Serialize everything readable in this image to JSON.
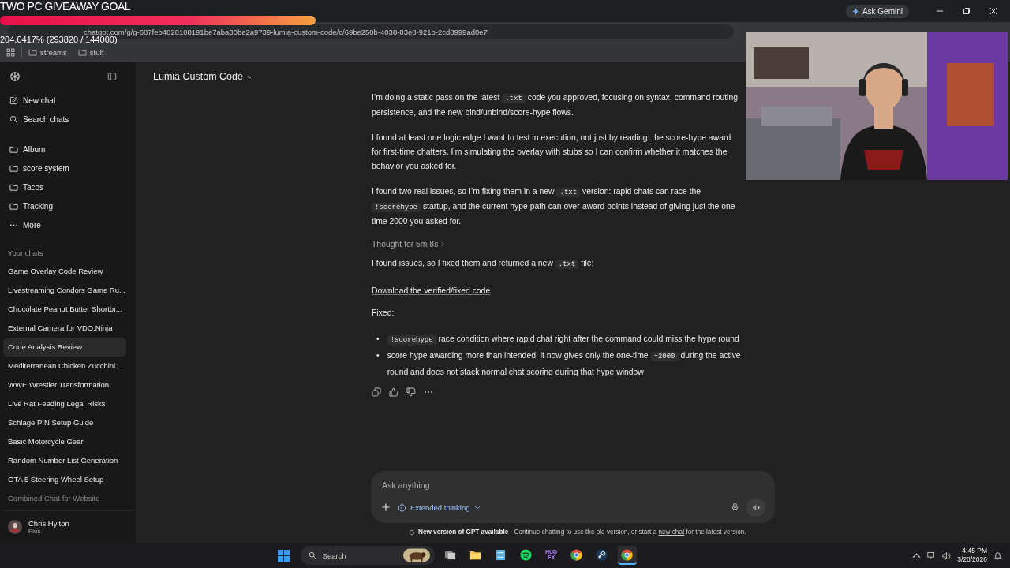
{
  "stream_overlay": {
    "goal_title": "TWO PC GIVEAWAY GOAL",
    "goal_progress": {
      "level": 1
    },
    "goal_reading": "204.0417% (293820 / 144000)"
  },
  "browser": {
    "gemini_button": "Ask Gemini",
    "url": "chatgpt.com/g/g-687feb4828108191be7aba30be2a9739-lumia-custom-code/c/69be250b-4038-83e8-921b-2cd8999ad0e7",
    "bookmarks": [
      "streams",
      "stuff"
    ]
  },
  "sidebar": {
    "nav": [
      {
        "label": "New chat",
        "kind": "edit"
      },
      {
        "label": "Search chats",
        "kind": "search"
      }
    ],
    "projects": [
      {
        "label": "Album",
        "kind": "folder"
      },
      {
        "label": "score system",
        "kind": "folder"
      },
      {
        "label": "Tacos",
        "kind": "folder"
      },
      {
        "label": "Tracking",
        "kind": "folder"
      },
      {
        "label": "More",
        "kind": "more"
      }
    ],
    "chats_heading": "Your chats",
    "chats": [
      {
        "title": "Game Overlay Code Review",
        "selected": false
      },
      {
        "title": "Livestreaming Condors Game Ru...",
        "selected": false
      },
      {
        "title": "Chocolate Peanut Butter Shortbr...",
        "selected": false
      },
      {
        "title": "External Camera for VDO.Ninja",
        "selected": false
      },
      {
        "title": "Code Analysis Review",
        "selected": true
      },
      {
        "title": "Mediterranean Chicken Zucchini...",
        "selected": false
      },
      {
        "title": "WWE Wrestler Transformation",
        "selected": false
      },
      {
        "title": "Live Rat Feeding Legal Risks",
        "selected": false
      },
      {
        "title": "Schlage PIN Setup Guide",
        "selected": false
      },
      {
        "title": "Basic Motorcycle Gear",
        "selected": false
      },
      {
        "title": "Random Number List Generation",
        "selected": false
      },
      {
        "title": "GTA 5 Steering Wheel Setup",
        "selected": false
      },
      {
        "title": "Combined Chat for Website",
        "selected": false
      }
    ],
    "user": {
      "name": "Chris Hylton",
      "plan": "Plus"
    }
  },
  "chat": {
    "title": "Lumia Custom Code",
    "blocks": [
      {
        "kind": "paragraph",
        "parts": [
          {
            "kind": "text",
            "text": "I’m doing a static pass on the latest "
          },
          {
            "kind": "code",
            "text": ".txt"
          },
          {
            "kind": "text",
            "text": " code you approved, focusing on syntax, command routing persistence, and the new bind/unbind/score-hype flows."
          }
        ]
      },
      {
        "kind": "paragraph",
        "parts": [
          {
            "kind": "text",
            "text": "I found at least one logic edge I want to test in execution, not just by reading: the score-hype award for first-time chatters. I’m simulating the overlay with stubs so I can confirm whether it matches the behavior you asked for."
          }
        ]
      },
      {
        "kind": "paragraph",
        "parts": [
          {
            "kind": "text",
            "text": "I found two real issues, so I’m fixing them in a new "
          },
          {
            "kind": "code",
            "text": ".txt"
          },
          {
            "kind": "text",
            "text": " version: rapid chats can race the "
          },
          {
            "kind": "code",
            "text": "!scorehype"
          },
          {
            "kind": "text",
            "text": " startup, and the current hype path can over-award points instead of giving just the one-time 2000 you asked for."
          }
        ]
      },
      {
        "kind": "thought",
        "text": "Thought for 5m 8s"
      },
      {
        "kind": "paragraph",
        "parts": [
          {
            "kind": "text",
            "text": "I found issues, so I fixed them and returned a new "
          },
          {
            "kind": "code",
            "text": ".txt"
          },
          {
            "kind": "text",
            "text": " file:"
          }
        ]
      },
      {
        "kind": "link",
        "text": "Download the verified/fixed code"
      },
      {
        "kind": "paragraph",
        "parts": [
          {
            "kind": "text",
            "text": "Fixed:"
          }
        ]
      },
      {
        "kind": "list",
        "marker": "•",
        "items": [
          [
            {
              "kind": "code",
              "text": "!scorehype"
            },
            {
              "kind": "text",
              "text": " race condition where rapid chat right after the command could miss the hype round"
            }
          ],
          [
            {
              "kind": "text",
              "text": "score hype awarding more than intended; it now gives only the one-time "
            },
            {
              "kind": "code",
              "text": "+2000"
            },
            {
              "kind": "text",
              "text": " during the active round and does not stack normal chat scoring during that hype window"
            }
          ]
        ]
      },
      {
        "kind": "actions"
      }
    ],
    "composer": {
      "placeholder": "Ask anything",
      "mode": "Extended thinking"
    },
    "notice": {
      "text": "**New version of GPT available** - Continue chatting to use the old version, or start a ",
      "link": "new chat",
      "after": " for the latest version."
    }
  },
  "taskbar": {
    "search_placeholder": "Search",
    "apps": [
      {
        "kind": "taskview",
        "active": false
      },
      {
        "kind": "explorer",
        "active": false
      },
      {
        "kind": "notepad",
        "active": false
      },
      {
        "kind": "spotify",
        "active": false
      },
      {
        "kind": "hudfx",
        "label": "HUD FX",
        "active": false
      },
      {
        "kind": "chrome",
        "active": false
      },
      {
        "kind": "steam",
        "active": false
      },
      {
        "kind": "chrome",
        "active": true
      }
    ],
    "time": "4:45 PM",
    "date": "3/28/2026"
  }
}
